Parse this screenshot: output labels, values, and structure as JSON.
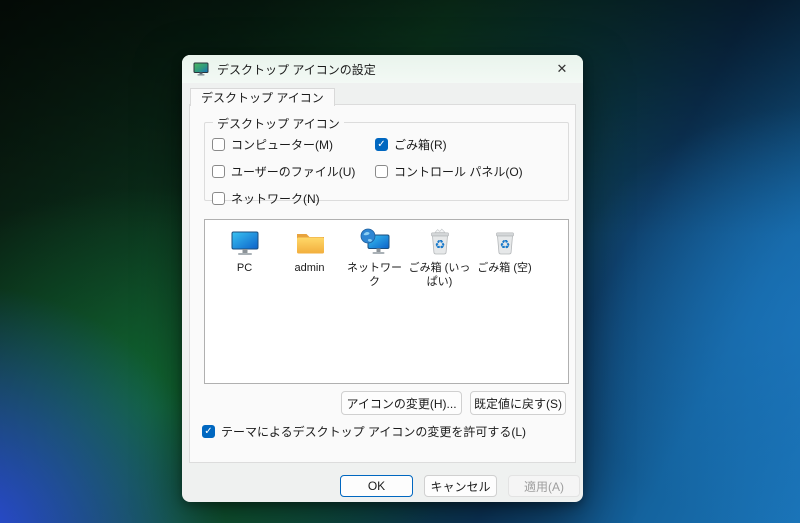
{
  "window": {
    "title": "デスクトップ アイコンの設定",
    "close": "✕"
  },
  "tab": {
    "label": "デスクトップ アイコン"
  },
  "group": {
    "label": "デスクトップ アイコン",
    "checkboxes": [
      {
        "label": "コンピューター(M)",
        "checked": false
      },
      {
        "label": "ごみ箱(R)",
        "checked": true
      },
      {
        "label": "ユーザーのファイル(U)",
        "checked": false
      },
      {
        "label": "コントロール パネル(O)",
        "checked": false
      },
      {
        "label": "ネットワーク(N)",
        "checked": false
      }
    ]
  },
  "icon_list": {
    "items": [
      {
        "label": "PC",
        "icon": "pc-icon"
      },
      {
        "label": "admin",
        "icon": "folder-icon"
      },
      {
        "label": "ネットワーク",
        "icon": "network-icon"
      },
      {
        "label": "ごみ箱 (いっぱい)",
        "icon": "recycle-bin-full-icon"
      },
      {
        "label": "ごみ箱 (空)",
        "icon": "recycle-bin-empty-icon"
      }
    ]
  },
  "actions": {
    "change_icon": "アイコンの変更(H)...",
    "restore_default": "既定値に戻す(S)"
  },
  "theme_checkbox": {
    "label": "テーマによるデスクトップ アイコンの変更を許可する(L)",
    "checked": true
  },
  "footer": {
    "ok": "OK",
    "cancel": "キャンセル",
    "apply": "適用(A)",
    "apply_disabled": true
  },
  "colors": {
    "accent": "#0067c0",
    "dialog_bg": "#eff1f0",
    "page_bg": "#fafafa",
    "titlebar_tint": "#edf6f0"
  }
}
